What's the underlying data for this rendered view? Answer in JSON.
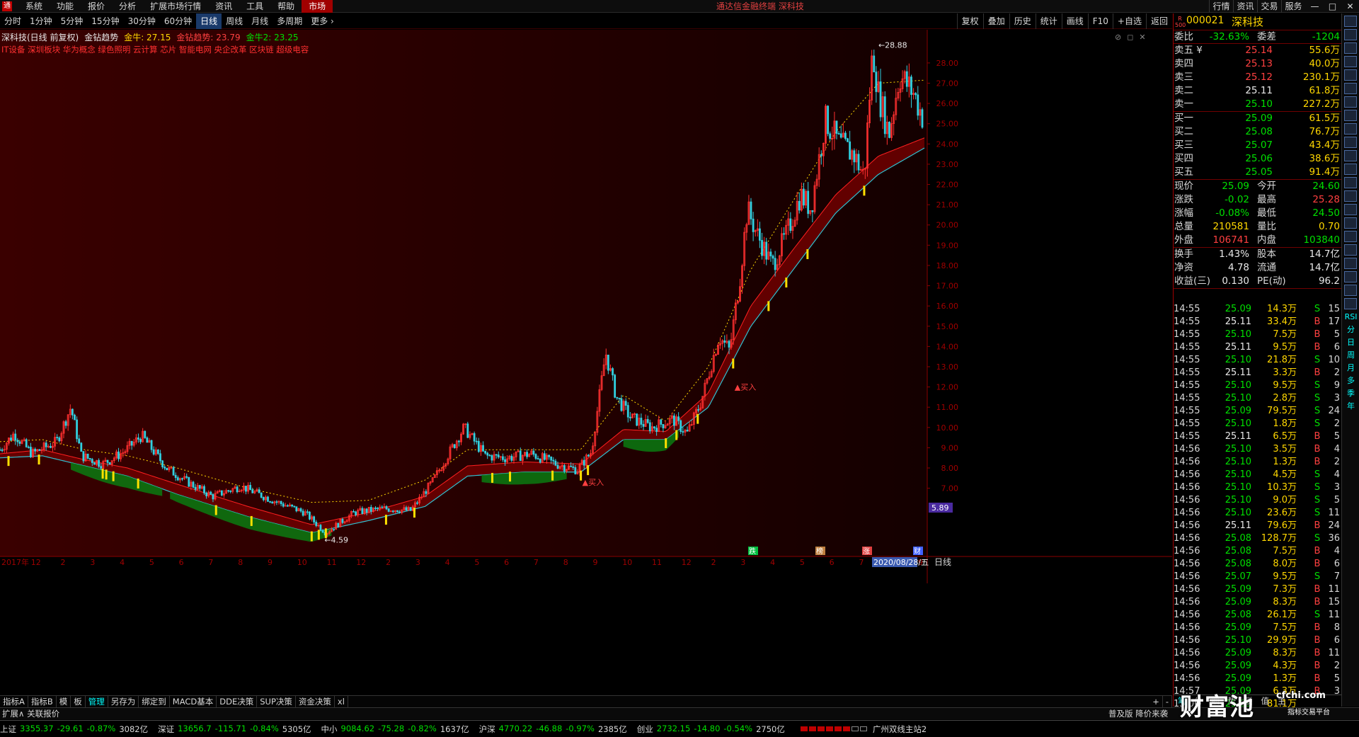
{
  "menu": {
    "logo": "通",
    "items": [
      "系统",
      "功能",
      "报价",
      "分析",
      "扩展市场行情",
      "资讯",
      "工具",
      "帮助",
      "市场"
    ],
    "title": "通达信金融终端 深科技",
    "right": [
      "行情",
      "资讯",
      "交易",
      "服务"
    ],
    "win": [
      "—",
      "□",
      "✕"
    ]
  },
  "period_tabs": [
    "分时",
    "1分钟",
    "5分钟",
    "15分钟",
    "30分钟",
    "60分钟",
    "日线",
    "周线",
    "月线",
    "多周期",
    "更多 ›"
  ],
  "tool_tabs": [
    "复权",
    "叠加",
    "历史",
    "统计",
    "画线",
    "F10",
    "+自选",
    "返回"
  ],
  "chart_info": {
    "stock_name": "深科技(日线 前复权)",
    "indicator": "金钻趋势",
    "v1": "金牛: 27.15",
    "v2": "金钻趋势: 23.79",
    "v3": "金牛2: 23.25"
  },
  "concept_line": "IT设备 深圳板块 华为概念 绿色照明 云计算 芯片 智能电网 央企改革 区块链 超级电容",
  "chart_ctrls": [
    "⊘",
    "◻",
    "✕"
  ],
  "chart_data": {
    "type": "candlestick",
    "ylim": [
      3.7,
      29.5
    ],
    "yticks": [
      28.0,
      27.0,
      26.0,
      25.0,
      24.0,
      23.0,
      22.0,
      21.0,
      20.0,
      19.0,
      18.0,
      17.0,
      16.0,
      15.0,
      14.0,
      13.0,
      12.0,
      11.0,
      10.0,
      9.0,
      8.0,
      7.0
    ],
    "current_price": "5.89",
    "high_label": "28.88",
    "low_label": "4.59",
    "x_labels": [
      "2017年",
      "12",
      "2",
      "3",
      "4",
      "5",
      "6",
      "7",
      "8",
      "9",
      "10",
      "11",
      "12",
      "2",
      "3",
      "4",
      "5",
      "6",
      "7",
      "8",
      "9",
      "10",
      "11",
      "12",
      "2",
      "3",
      "4",
      "5",
      "6",
      "7",
      "8",
      "9"
    ],
    "x_right_label": "日线",
    "date_badge": "2020/08/28/五",
    "buy_label": "买入",
    "event_marks": [
      "跌",
      "榜",
      "涨",
      "财"
    ],
    "anchors": [
      [
        0,
        8.9
      ],
      [
        20,
        9.7
      ],
      [
        45,
        8.7
      ],
      [
        80,
        9.3
      ],
      [
        100,
        11.0
      ],
      [
        115,
        8.6
      ],
      [
        145,
        8.2
      ],
      [
        175,
        8.8
      ],
      [
        200,
        9.6
      ],
      [
        235,
        8.0
      ],
      [
        265,
        7.3
      ],
      [
        300,
        6.6
      ],
      [
        340,
        7.1
      ],
      [
        385,
        6.4
      ],
      [
        430,
        5.8
      ],
      [
        460,
        4.8
      ],
      [
        500,
        5.8
      ],
      [
        540,
        6.0
      ],
      [
        580,
        5.9
      ],
      [
        610,
        7.3
      ],
      [
        640,
        9.1
      ],
      [
        655,
        10.0
      ],
      [
        685,
        8.6
      ],
      [
        715,
        8.5
      ],
      [
        750,
        8.7
      ],
      [
        785,
        8.2
      ],
      [
        815,
        7.9
      ],
      [
        835,
        8.8
      ],
      [
        855,
        13.7
      ],
      [
        870,
        11.5
      ],
      [
        890,
        10.5
      ],
      [
        920,
        10.0
      ],
      [
        950,
        10.4
      ],
      [
        970,
        9.7
      ],
      [
        990,
        11.3
      ],
      [
        1015,
        14.5
      ],
      [
        1030,
        13.8
      ],
      [
        1045,
        17.5
      ],
      [
        1055,
        20.8
      ],
      [
        1068,
        19.6
      ],
      [
        1090,
        18.0
      ],
      [
        1110,
        19.5
      ],
      [
        1130,
        21.5
      ],
      [
        1145,
        20.8
      ],
      [
        1165,
        25.2
      ],
      [
        1185,
        24.0
      ],
      [
        1205,
        23.5
      ],
      [
        1220,
        22.4
      ],
      [
        1232,
        28.7
      ],
      [
        1240,
        26.5
      ],
      [
        1255,
        24.5
      ],
      [
        1270,
        27.4
      ],
      [
        1290,
        26.5
      ],
      [
        1305,
        25.09
      ]
    ],
    "band_upper_anchors": [
      [
        0,
        8.7
      ],
      [
        60,
        8.9
      ],
      [
        120,
        8.4
      ],
      [
        180,
        8.0
      ],
      [
        250,
        7.2
      ],
      [
        350,
        6.1
      ],
      [
        440,
        5.2
      ],
      [
        520,
        5.8
      ],
      [
        600,
        6.6
      ],
      [
        660,
        8.1
      ],
      [
        740,
        8.3
      ],
      [
        820,
        8.2
      ],
      [
        880,
        9.9
      ],
      [
        940,
        9.8
      ],
      [
        1000,
        11.7
      ],
      [
        1060,
        16.0
      ],
      [
        1120,
        18.8
      ],
      [
        1180,
        21.5
      ],
      [
        1240,
        23.4
      ],
      [
        1305,
        24.3
      ]
    ],
    "band_lower_anchors": [
      [
        0,
        8.5
      ],
      [
        60,
        8.6
      ],
      [
        120,
        8.1
      ],
      [
        180,
        7.6
      ],
      [
        250,
        6.7
      ],
      [
        350,
        5.6
      ],
      [
        440,
        4.8
      ],
      [
        520,
        5.4
      ],
      [
        600,
        6.1
      ],
      [
        660,
        7.6
      ],
      [
        740,
        7.8
      ],
      [
        820,
        7.8
      ],
      [
        880,
        9.4
      ],
      [
        940,
        9.4
      ],
      [
        1000,
        11.0
      ],
      [
        1060,
        15.0
      ],
      [
        1120,
        17.8
      ],
      [
        1180,
        20.6
      ],
      [
        1240,
        22.5
      ],
      [
        1305,
        23.8
      ]
    ],
    "dotted_line_anchors": [
      [
        0,
        9.3
      ],
      [
        60,
        9.4
      ],
      [
        120,
        8.9
      ],
      [
        180,
        8.6
      ],
      [
        250,
        8.0
      ],
      [
        350,
        7.0
      ],
      [
        440,
        6.3
      ],
      [
        520,
        6.4
      ],
      [
        600,
        7.4
      ],
      [
        660,
        8.9
      ],
      [
        740,
        8.9
      ],
      [
        820,
        8.9
      ],
      [
        880,
        11.6
      ],
      [
        940,
        10.3
      ],
      [
        1000,
        13.0
      ],
      [
        1060,
        17.8
      ],
      [
        1120,
        21.2
      ],
      [
        1180,
        24.6
      ],
      [
        1240,
        27.0
      ],
      [
        1305,
        27.15
      ]
    ]
  },
  "quote": {
    "rbox": "R 500",
    "code": "000021",
    "name": "深科技",
    "weibi_label": "委比",
    "weibi": "-32.63%",
    "weicha_label": "委差",
    "weicha": "-1204",
    "asks": [
      {
        "label": "卖五 ¥",
        "price": "25.14",
        "vol": "55.6万"
      },
      {
        "label": "卖四",
        "price": "25.13",
        "vol": "40.0万"
      },
      {
        "label": "卖三",
        "price": "25.12",
        "vol": "230.1万"
      },
      {
        "label": "卖二",
        "price": "25.11",
        "vol": "61.8万"
      },
      {
        "label": "卖一",
        "price": "25.10",
        "vol": "227.2万"
      }
    ],
    "bids": [
      {
        "label": "买一",
        "price": "25.09",
        "vol": "61.5万"
      },
      {
        "label": "买二",
        "price": "25.08",
        "vol": "76.7万"
      },
      {
        "label": "买三",
        "price": "25.07",
        "vol": "43.4万"
      },
      {
        "label": "买四",
        "price": "25.06",
        "vol": "38.6万"
      },
      {
        "label": "买五",
        "price": "25.05",
        "vol": "91.4万"
      }
    ],
    "stats": [
      {
        "l1": "现价",
        "v1": "25.09",
        "c1": "green",
        "l2": "今开",
        "v2": "24.60",
        "c2": "green"
      },
      {
        "l1": "涨跌",
        "v1": "-0.02",
        "c1": "green",
        "l2": "最高",
        "v2": "25.28",
        "c2": "red"
      },
      {
        "l1": "涨幅",
        "v1": "-0.08%",
        "c1": "green",
        "l2": "最低",
        "v2": "24.50",
        "c2": "green"
      },
      {
        "l1": "总量",
        "v1": "210581",
        "c1": "yellow",
        "l2": "量比",
        "v2": "0.70",
        "c2": "yellow"
      },
      {
        "l1": "外盘",
        "v1": "106741",
        "c1": "red",
        "l2": "内盘",
        "v2": "103840",
        "c2": "green"
      }
    ],
    "fund": [
      {
        "l1": "换手",
        "v1": "1.43%",
        "l2": "股本",
        "v2": "14.7亿"
      },
      {
        "l1": "净资",
        "v1": "4.78",
        "l2": "流通",
        "v2": "14.7亿"
      },
      {
        "l1": "收益(三)",
        "v1": "0.130",
        "l2": "PE(动)",
        "v2": "96.2"
      }
    ]
  },
  "ticks": [
    {
      "t": "14:55",
      "p": "25.09",
      "pc": "green",
      "q": "14.3万",
      "d": "S",
      "n": "15"
    },
    {
      "t": "14:55",
      "p": "25.11",
      "pc": "white",
      "q": "33.4万",
      "d": "B",
      "n": "17"
    },
    {
      "t": "14:55",
      "p": "25.10",
      "pc": "green",
      "q": "7.5万",
      "d": "B",
      "n": "5"
    },
    {
      "t": "14:55",
      "p": "25.11",
      "pc": "white",
      "q": "9.5万",
      "d": "B",
      "n": "6"
    },
    {
      "t": "14:55",
      "p": "25.10",
      "pc": "green",
      "q": "21.8万",
      "d": "S",
      "n": "10"
    },
    {
      "t": "14:55",
      "p": "25.11",
      "pc": "white",
      "q": "3.3万",
      "d": "B",
      "n": "2"
    },
    {
      "t": "14:55",
      "p": "25.10",
      "pc": "green",
      "q": "9.5万",
      "d": "S",
      "n": "9"
    },
    {
      "t": "14:55",
      "p": "25.10",
      "pc": "green",
      "q": "2.8万",
      "d": "S",
      "n": "3"
    },
    {
      "t": "14:55",
      "p": "25.09",
      "pc": "green",
      "q": "79.5万",
      "d": "S",
      "n": "24"
    },
    {
      "t": "14:55",
      "p": "25.10",
      "pc": "green",
      "q": "1.8万",
      "d": "S",
      "n": "2"
    },
    {
      "t": "14:55",
      "p": "25.11",
      "pc": "white",
      "q": "6.5万",
      "d": "B",
      "n": "5"
    },
    {
      "t": "14:56",
      "p": "25.10",
      "pc": "green",
      "q": "3.5万",
      "d": "B",
      "n": "4"
    },
    {
      "t": "14:56",
      "p": "25.10",
      "pc": "green",
      "q": "1.3万",
      "d": "B",
      "n": "2"
    },
    {
      "t": "14:56",
      "p": "25.10",
      "pc": "green",
      "q": "4.5万",
      "d": "S",
      "n": "4"
    },
    {
      "t": "14:56",
      "p": "25.10",
      "pc": "green",
      "q": "10.3万",
      "d": "S",
      "n": "3"
    },
    {
      "t": "14:56",
      "p": "25.10",
      "pc": "green",
      "q": "9.0万",
      "d": "S",
      "n": "5"
    },
    {
      "t": "14:56",
      "p": "25.10",
      "pc": "green",
      "q": "23.6万",
      "d": "S",
      "n": "11"
    },
    {
      "t": "14:56",
      "p": "25.11",
      "pc": "white",
      "q": "79.6万",
      "d": "B",
      "n": "24"
    },
    {
      "t": "14:56",
      "p": "25.08",
      "pc": "green",
      "q": "128.7万",
      "qc": "magenta",
      "d": "S",
      "n": "36"
    },
    {
      "t": "14:56",
      "p": "25.08",
      "pc": "green",
      "q": "7.5万",
      "d": "B",
      "n": "4"
    },
    {
      "t": "14:56",
      "p": "25.08",
      "pc": "green",
      "q": "8.0万",
      "d": "B",
      "n": "6"
    },
    {
      "t": "14:56",
      "p": "25.07",
      "pc": "green",
      "q": "9.5万",
      "d": "S",
      "n": "7"
    },
    {
      "t": "14:56",
      "p": "25.09",
      "pc": "green",
      "q": "7.3万",
      "d": "B",
      "n": "11"
    },
    {
      "t": "14:56",
      "p": "25.09",
      "pc": "green",
      "q": "8.3万",
      "d": "B",
      "n": "15"
    },
    {
      "t": "14:56",
      "p": "25.08",
      "pc": "green",
      "q": "26.1万",
      "d": "S",
      "n": "11"
    },
    {
      "t": "14:56",
      "p": "25.09",
      "pc": "green",
      "q": "7.5万",
      "d": "B",
      "n": "8"
    },
    {
      "t": "14:56",
      "p": "25.10",
      "pc": "green",
      "q": "29.9万",
      "d": "B",
      "n": "6"
    },
    {
      "t": "14:56",
      "p": "25.09",
      "pc": "green",
      "q": "8.3万",
      "d": "B",
      "n": "11"
    },
    {
      "t": "14:56",
      "p": "25.09",
      "pc": "green",
      "q": "4.3万",
      "d": "B",
      "n": "2"
    },
    {
      "t": "14:56",
      "p": "25.09",
      "pc": "green",
      "q": "1.3万",
      "d": "B",
      "n": "5"
    },
    {
      "t": "14:57",
      "p": "25.09",
      "pc": "green",
      "q": "6.3万",
      "d": "B",
      "n": "3"
    },
    {
      "t": "15:00",
      "p": "25.09",
      "pc": "green",
      "q": "81.1万",
      "d": "",
      "n": ""
    }
  ],
  "panel_foot": [
    "笔",
    "价",
    "细",
    "势",
    "联",
    "值",
    "主"
  ],
  "ind_tabs": [
    "指标A",
    "指标B",
    "模",
    "板",
    "管理",
    "另存为",
    "绑定到",
    "MACD基本",
    "DDE决策",
    "SUP决策",
    "资金决策",
    "xl"
  ],
  "ind_tabs_right": [
    "+",
    "-"
  ],
  "expand_left": "扩展∧  关联报价",
  "expand_right": [
    "普及版 降价来袭"
  ],
  "status": {
    "indices": [
      {
        "nm": "上证",
        "pt": "3355.37",
        "ch": "-29.61",
        "pct": "-0.87%",
        "vol": "3082亿"
      },
      {
        "nm": "深证",
        "pt": "13656.7",
        "ch": "-115.71",
        "pct": "-0.84%",
        "vol": "5305亿"
      },
      {
        "nm": "中小",
        "pt": "9084.62",
        "ch": "-75.28",
        "pct": "-0.82%",
        "vol": "1637亿"
      },
      {
        "nm": "沪深",
        "pt": "4770.22",
        "ch": "-46.88",
        "pct": "-0.97%",
        "vol": "2385亿"
      },
      {
        "nm": "创业",
        "pt": "2732.15",
        "ch": "-14.80",
        "pct": "-0.54%",
        "vol": "2750亿"
      }
    ],
    "conn": "广州双线主站2"
  },
  "sidebar_buttons": [
    "a",
    "b",
    "c",
    "d",
    "e",
    "f",
    "g",
    "h",
    "i",
    "j",
    "k",
    "l",
    "m",
    "n",
    "o",
    "p",
    "q",
    "r",
    "s",
    "t",
    "u",
    "v"
  ],
  "sidebar_text": [
    "RSI",
    "分",
    "日",
    "周",
    "月",
    "多",
    "季",
    "年"
  ],
  "watermark": {
    "big": "财富池",
    "url": "cfchi.com",
    "sub": "指标交易平台"
  }
}
